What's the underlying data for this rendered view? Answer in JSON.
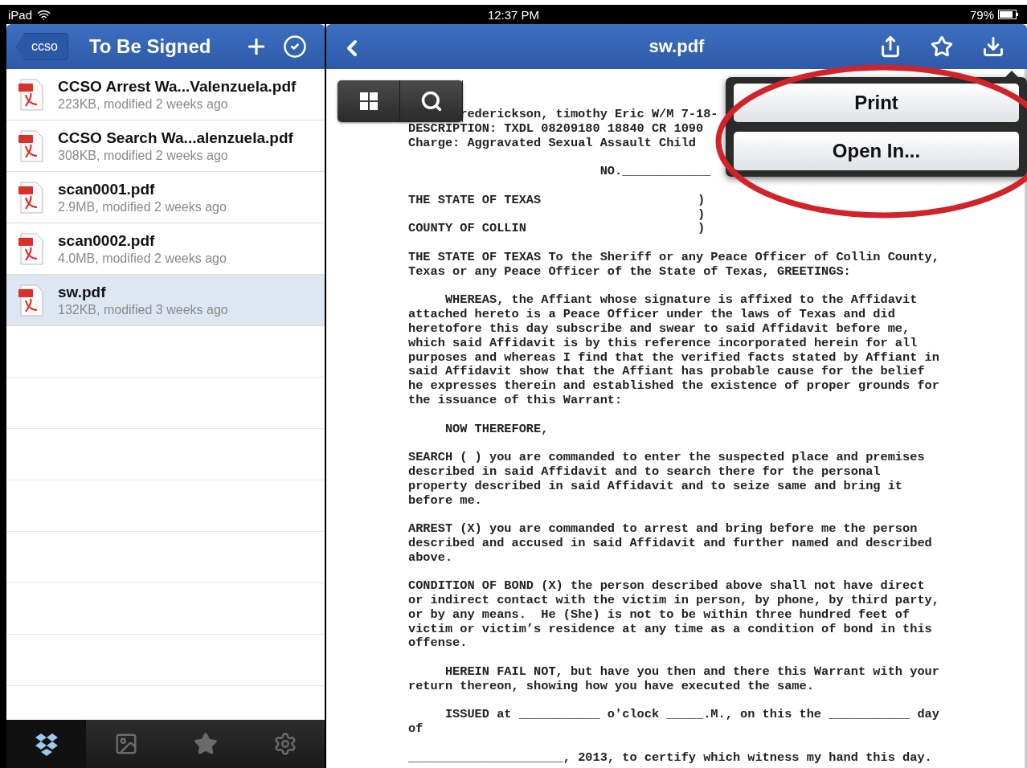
{
  "status_bar": {
    "device": "iPad",
    "time": "12:37 PM",
    "battery": "79%"
  },
  "sidebar": {
    "back_button": "ccso",
    "title": "To Be Signed",
    "files": [
      {
        "name": "CCSO Arrest Wa...Valenzuela.pdf",
        "meta": "223KB, modified 2 weeks ago",
        "selected": false
      },
      {
        "name": "CCSO Search Wa...alenzuela.pdf",
        "meta": "308KB, modified 2 weeks ago",
        "selected": false
      },
      {
        "name": "scan0001.pdf",
        "meta": "2.9MB, modified 2 weeks ago",
        "selected": false
      },
      {
        "name": "scan0002.pdf",
        "meta": "4.0MB, modified 2 weeks ago",
        "selected": false
      },
      {
        "name": "sw.pdf",
        "meta": "132KB, modified 3 weeks ago",
        "selected": true
      }
    ],
    "tab_bar": [
      {
        "kind": "dropbox",
        "selected": true
      },
      {
        "kind": "photos",
        "selected": false
      },
      {
        "kind": "favorites",
        "selected": false
      },
      {
        "kind": "settings",
        "selected": false
      }
    ]
  },
  "viewer": {
    "title": "sw.pdf",
    "menu": [
      "Print",
      "Open In..."
    ],
    "document": [
      {
        "kind": "text",
        "indent": false,
        "lines": [
          "rederickson, timothy Eric W/M 7-18-",
          "DESCRIPTION: TXDL 08209180 18840 CR 1090",
          "Charge: Aggravated Sexual Assault Child"
        ]
      },
      {
        "kind": "center",
        "lines": [
          "NO.____________"
        ]
      },
      {
        "kind": "caption",
        "rows": [
          {
            "left": "THE STATE OF TEXAS",
            "right": ")"
          },
          {
            "left": "",
            "right": ")"
          },
          {
            "left": "COUNTY OF COLLIN",
            "right": ")"
          }
        ]
      },
      {
        "kind": "text",
        "indent": false,
        "lines": [
          "THE STATE OF TEXAS To the Sheriff or any Peace Officer of Collin County,",
          "Texas or any Peace Officer of the State of Texas, GREETINGS:"
        ]
      },
      {
        "kind": "text",
        "indent": true,
        "lines": [
          "WHEREAS, the Affiant whose signature is affixed to the Affidavit",
          "attached hereto is a Peace Officer under the laws of Texas and did",
          "heretofore this day subscribe and swear to said Affidavit before me,",
          "which said Affidavit is by this reference incorporated herein for all",
          "purposes and whereas I find that the verified facts stated by Affiant in",
          "said Affidavit show that the Affiant has probable cause for the belief",
          "he expresses therein and established the existence of proper grounds for",
          "the issuance of this Warrant:"
        ]
      },
      {
        "kind": "text",
        "indent": true,
        "lines": [
          "NOW THEREFORE,"
        ]
      },
      {
        "kind": "text",
        "indent": false,
        "lines": [
          "SEARCH ( ) you are commanded to enter the suspected place and premises",
          "described in said Affidavit and to search there for the personal",
          "property described in said Affidavit and to seize same and bring it",
          "before me."
        ]
      },
      {
        "kind": "text",
        "indent": false,
        "lines": [
          "ARREST (X) you are commanded to arrest and bring before me the person",
          "described and accused in said Affidavit and further named and described",
          "above."
        ]
      },
      {
        "kind": "text",
        "indent": false,
        "lines": [
          "CONDITION OF BOND (X) the person described above shall not have direct",
          "or indirect contact with the victim in person, by phone, by third party,",
          "or by any means.  He (She) is not to be within three hundred feet of",
          "victim or victim’s residence at any time as a condition of bond in this",
          "offense."
        ]
      },
      {
        "kind": "text",
        "indent": true,
        "lines": [
          "HEREIN FAIL NOT, but have you then and there this Warrant with your",
          "return thereon, showing how you have executed the same."
        ]
      },
      {
        "kind": "text",
        "indent": true,
        "lines": [
          "ISSUED at ___________ o'clock _____.M., on this the ___________ day",
          "of"
        ]
      },
      {
        "kind": "text",
        "indent": false,
        "lines": [
          "_____________________, 2013, to certify which witness my hand this day."
        ]
      }
    ]
  }
}
